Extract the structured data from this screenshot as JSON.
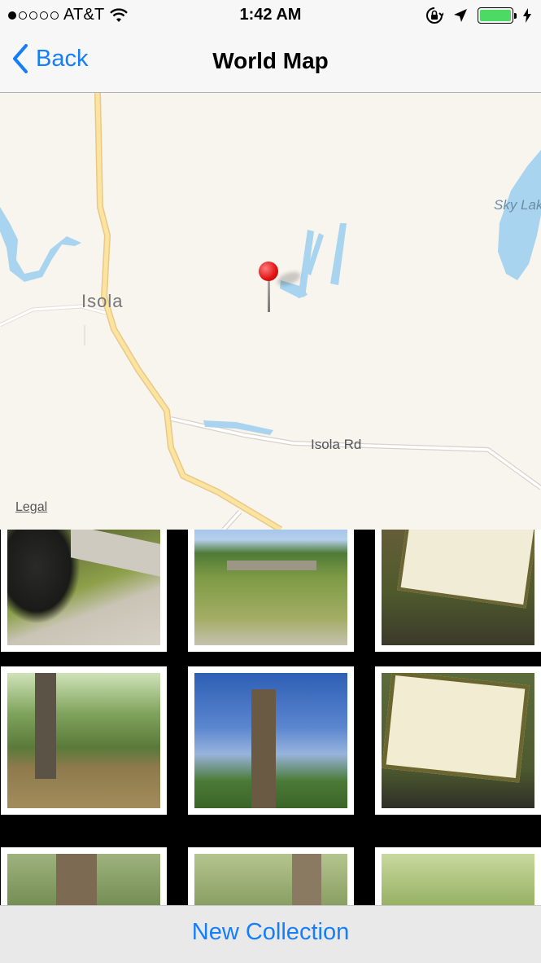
{
  "status_bar": {
    "signal_dots": [
      "filled",
      "empty",
      "empty",
      "empty",
      "empty"
    ],
    "carrier": "AT&T",
    "time": "1:42 AM",
    "icons": [
      "wifi-icon",
      "orientation-lock-icon",
      "location-arrow-icon",
      "battery-icon",
      "charging-bolt-icon"
    ],
    "battery_color": "#4cd964"
  },
  "nav": {
    "back_label": "Back",
    "title": "World Map",
    "tint": "#157efb"
  },
  "map": {
    "labels": {
      "town": "Isola",
      "lake": "Sky Lake",
      "road": "Isola Rd"
    },
    "legal": "Legal",
    "pin_color": "#e0120f",
    "water_color": "#a8d4ef",
    "road_color": "#fde3a0"
  },
  "photos": [
    {
      "subject": "tree trunk and sidewalk"
    },
    {
      "subject": "grassy field with stone wall"
    },
    {
      "subject": "cypress sign"
    },
    {
      "subject": "flooded forest"
    },
    {
      "subject": "tall tree against blue sky"
    },
    {
      "subject": "All in the Family sign"
    },
    {
      "subject": "forest trees"
    },
    {
      "subject": "forest trees"
    },
    {
      "subject": "green forest"
    }
  ],
  "bottom_bar": {
    "new_collection_label": "New Collection"
  }
}
